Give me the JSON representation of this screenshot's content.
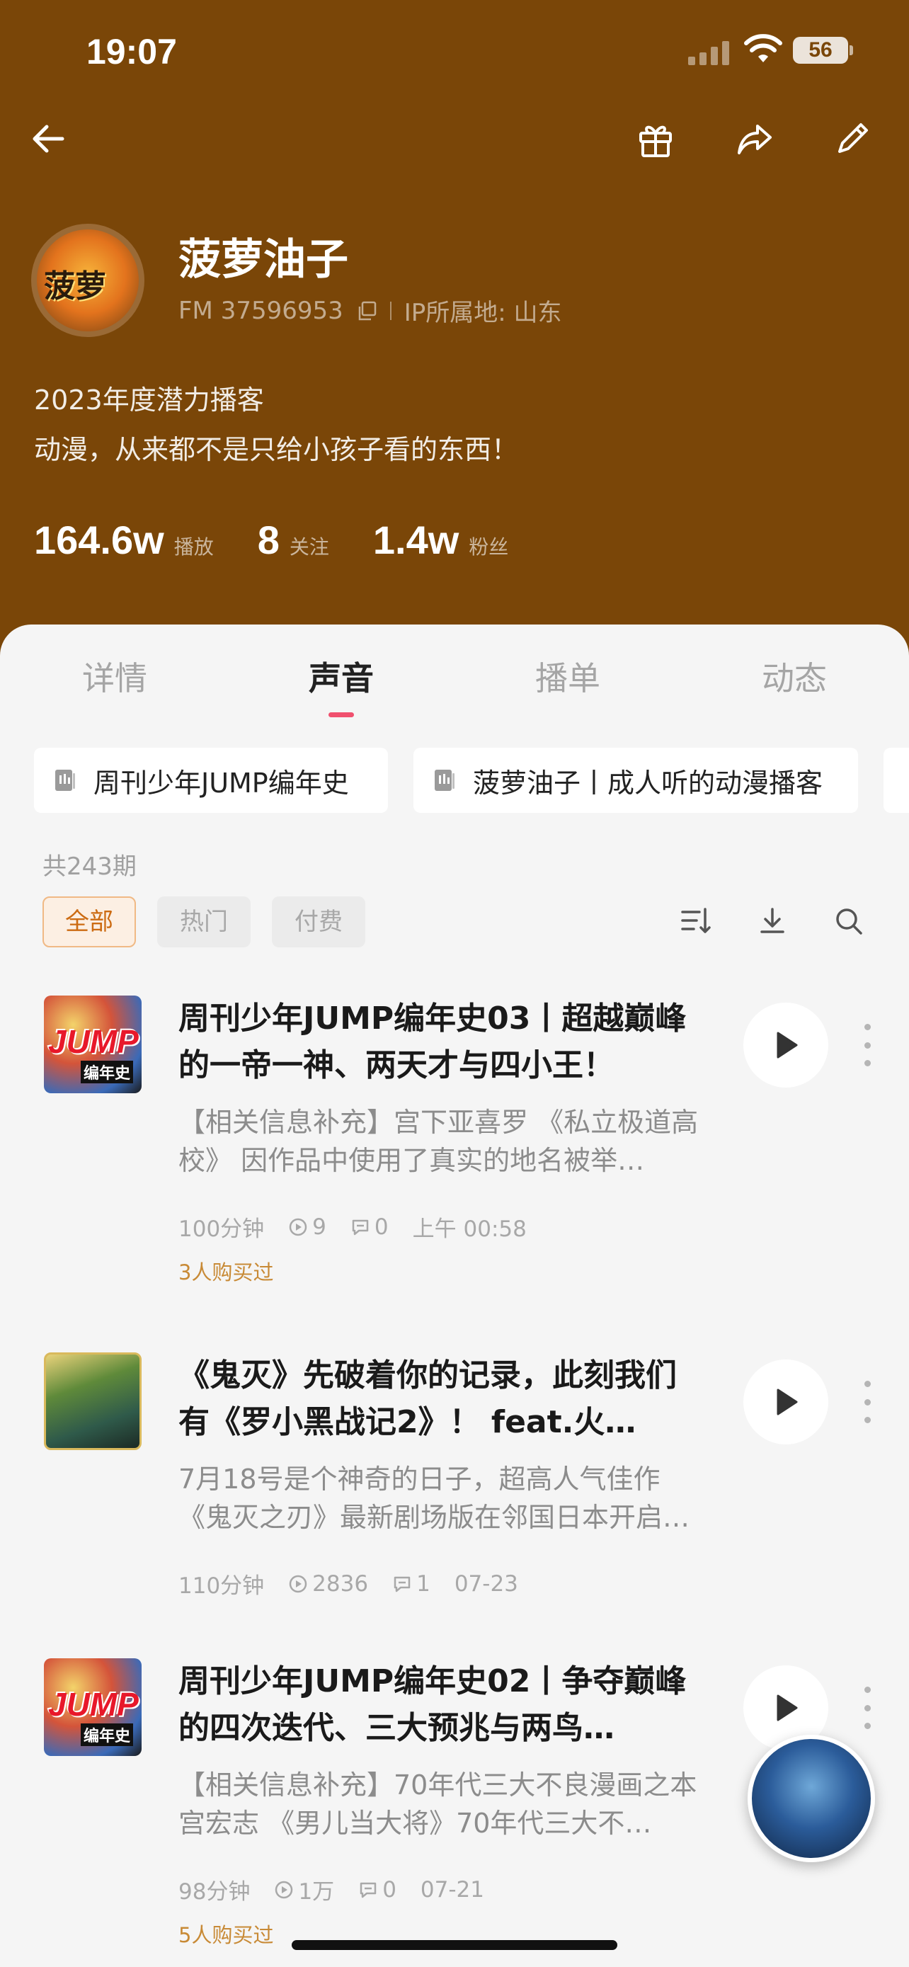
{
  "status_bar": {
    "time": "19:07",
    "battery": "56"
  },
  "profile": {
    "name": "菠萝油子",
    "fm_id": "FM 37596953",
    "ip_location": "IP所属地: 山东",
    "bio_line1": "2023年度潜力播客",
    "bio_line2": "动漫，从来都不是只给小孩子看的东西！",
    "avatar_text": "菠萝",
    "stats": [
      {
        "value": "164.6w",
        "label": "播放"
      },
      {
        "value": "8",
        "label": "关注"
      },
      {
        "value": "1.4w",
        "label": "粉丝"
      }
    ]
  },
  "tabs": [
    "详情",
    "声音",
    "播单",
    "动态"
  ],
  "active_tab": "声音",
  "albums": [
    "周刊少年JUMP编年史",
    "菠萝油子丨成人听的动漫播客"
  ],
  "episode_count": "共243期",
  "filters": [
    "全部",
    "热门",
    "付费"
  ],
  "episodes": [
    {
      "title": "周刊少年JUMP编年史03丨超越巅峰的一帝一神、两天才与四小王！",
      "desc": "【相关信息补充】宫下亚喜罗 《私立极道高校》 因作品中使用了真实的地名被举…",
      "duration": "100分钟",
      "plays": "9",
      "comments": "0",
      "time": "上午 00:58",
      "purchased": "3人购买过",
      "cover_text": "JUMP",
      "cover_sub": "编年史"
    },
    {
      "title": "《鬼灭》先破着你的记录，此刻我们有《罗小黑战记2》！ feat.火…",
      "desc": "7月18号是个神奇的日子，超高人气佳作《鬼灭之刃》最新剧场版在邻国日本开启…",
      "duration": "110分钟",
      "plays": "2836",
      "comments": "1",
      "time": "07-23",
      "purchased": ""
    },
    {
      "title": "周刊少年JUMP编年史02丨争夺巅峰的四次迭代、三大预兆与两鸟…",
      "desc": "【相关信息补充】70年代三大不良漫画之本宫宏志 《男儿当大将》70年代三大不…",
      "duration": "98分钟",
      "plays": "1万",
      "comments": "0",
      "time": "07-21",
      "purchased": "5人购买过",
      "cover_text": "JUMP",
      "cover_sub": "编年史"
    }
  ],
  "colors": {
    "header_bg": "#7a4608",
    "accent": "#f0506e",
    "filter_active": "#cc6b12"
  }
}
